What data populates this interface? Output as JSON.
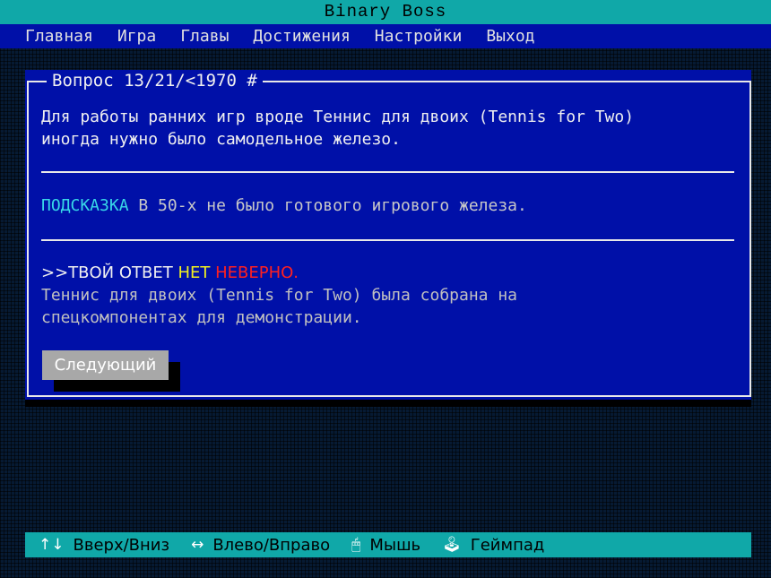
{
  "title": "Binary Boss",
  "menu": [
    "Главная",
    "Игра",
    "Главы",
    "Достижения",
    "Настройки",
    "Выход"
  ],
  "question": {
    "header": "Вопрос 13/21/<1970 #",
    "text": "Для работы ранних игр вроде Теннис для двоих (Tennis for Two)\nиногда нужно было самодельное железо."
  },
  "hint": {
    "label": "ПОДСКАЗКА",
    "text": " В 50-х не было готового игрового железа."
  },
  "answer": {
    "prefix": ">>ТВОЙ ОТВЕТ ",
    "value": "НЕТ",
    "result": " НЕВЕРНО.",
    "explanation": "Теннис для двоих (Tennis for Two) была собрана на\nспецкомпонентах для демонстрации."
  },
  "next_button": "Следующий",
  "status": [
    {
      "icon": "up-down-arrows-icon",
      "glyph": "↑↓",
      "label": "Вверх/Вниз"
    },
    {
      "icon": "left-right-arrows-icon",
      "glyph": "↔",
      "label": "Влево/Вправо"
    },
    {
      "icon": "mouse-icon",
      "glyph": "🖱",
      "label": "Мышь"
    },
    {
      "icon": "joystick-icon",
      "glyph": "🕹",
      "label": "Геймпад"
    }
  ],
  "colors": {
    "titlebar": "#10a8a8",
    "window": "#0010a8",
    "hint_label": "#38d8e8",
    "answer_value": "#f0f020",
    "answer_wrong": "#ff2020"
  }
}
